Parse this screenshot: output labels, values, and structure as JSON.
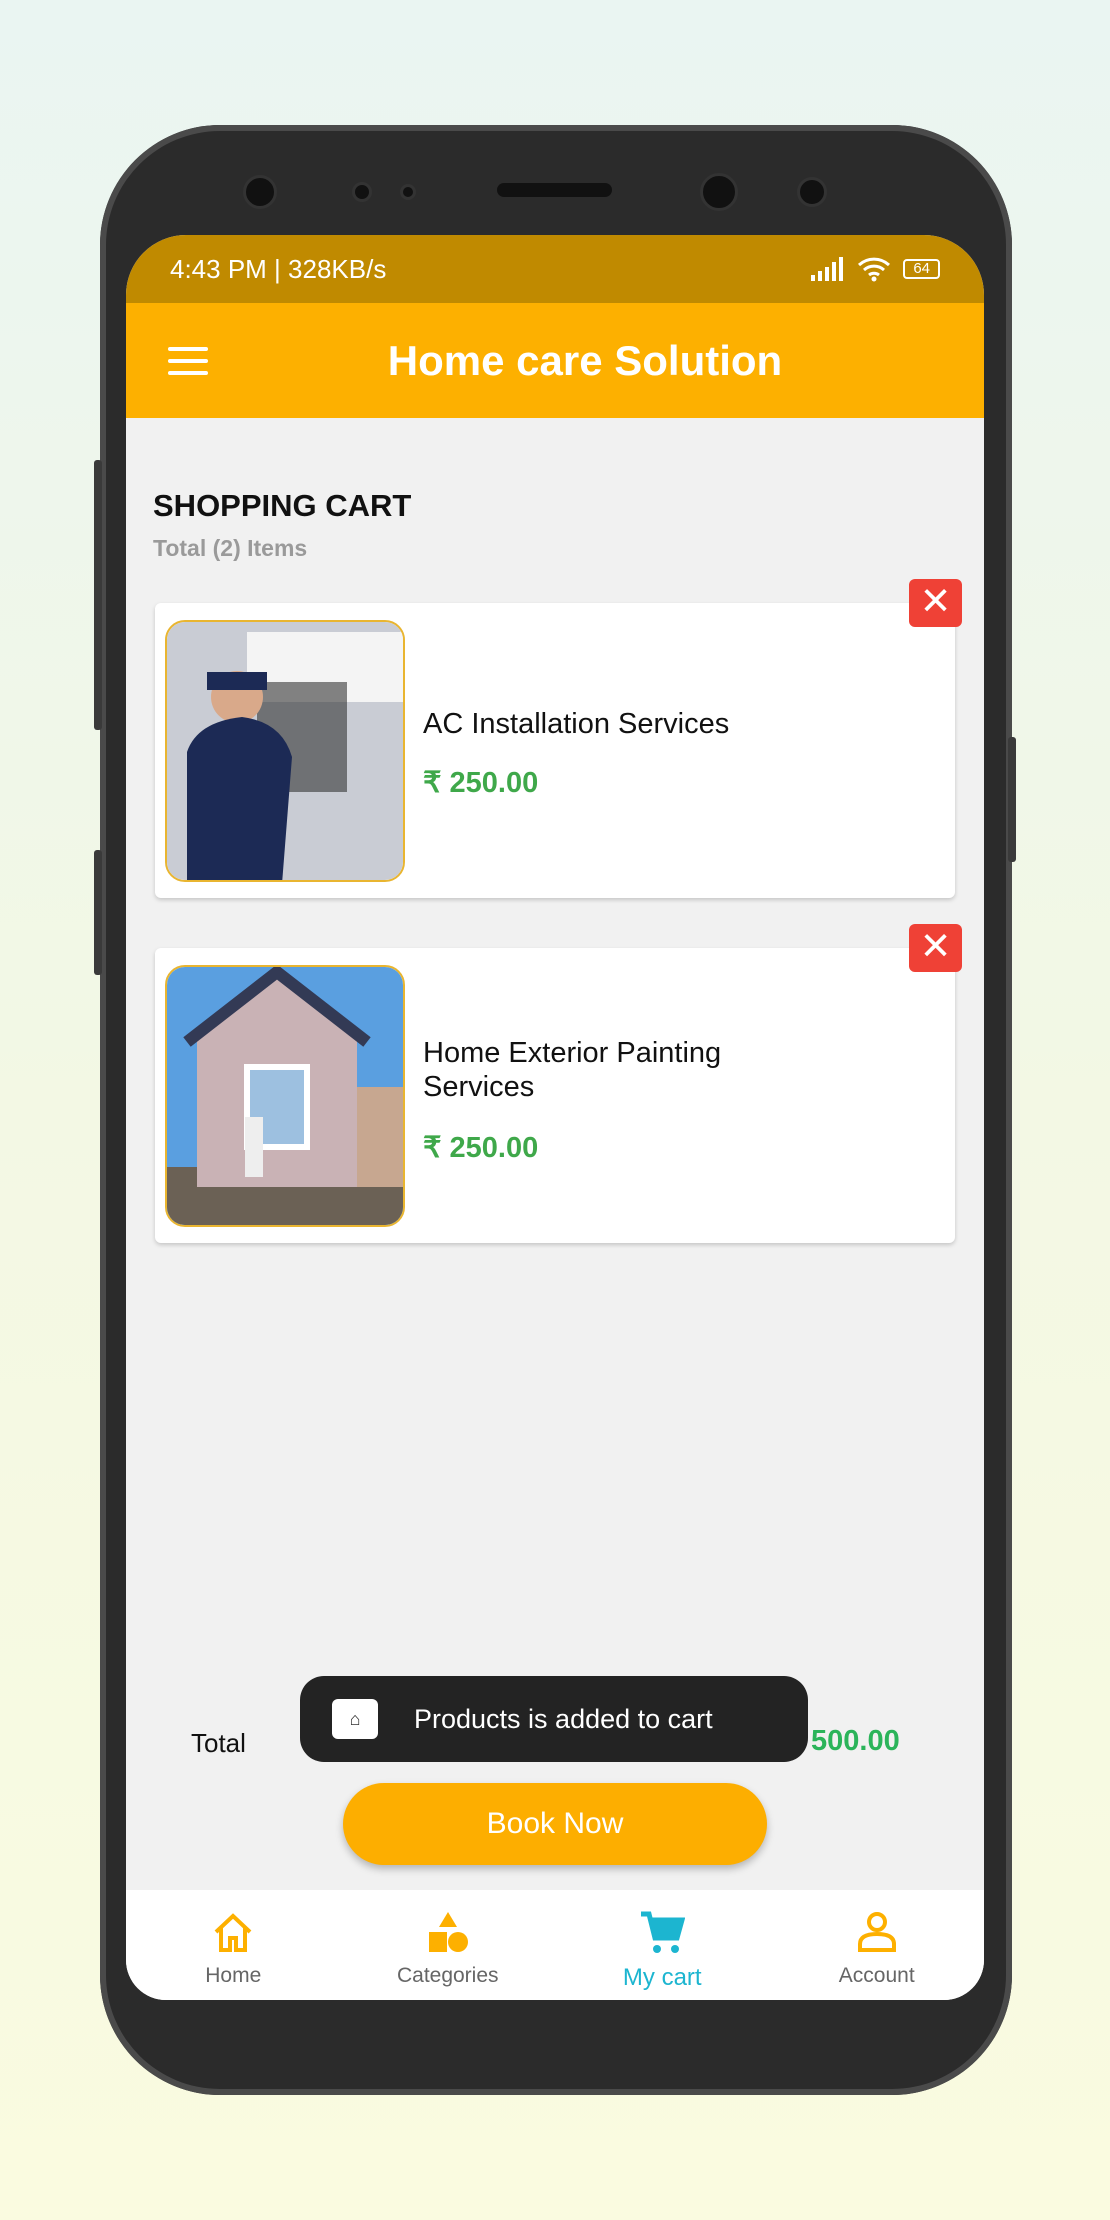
{
  "status_bar": {
    "time": "4:43 PM | 328KB/s",
    "battery": "64"
  },
  "app_bar": {
    "title": "Home care Solution"
  },
  "cart": {
    "heading": "SHOPPING CART",
    "count_text": "Total (2) Items",
    "items": [
      {
        "name": "AC Installation Services",
        "price": "₹ 250.00",
        "remove": "✕"
      },
      {
        "name": "Home Exterior Painting Services",
        "price": "₹ 250.00",
        "remove": "✕"
      }
    ],
    "total_label": "Total",
    "total_value": "500.00",
    "book_label": "Book Now"
  },
  "toast": {
    "message": "Products  is added to cart"
  },
  "nav": {
    "items": [
      {
        "label": "Home"
      },
      {
        "label": "Categories"
      },
      {
        "label": "My cart"
      },
      {
        "label": "Account"
      }
    ],
    "active": "My cart"
  },
  "colors": {
    "accent": "#fdb000",
    "status_bar": "#c08a00",
    "price": "#3fa84a",
    "active_nav": "#1cb5d0",
    "remove": "#ef4136"
  }
}
